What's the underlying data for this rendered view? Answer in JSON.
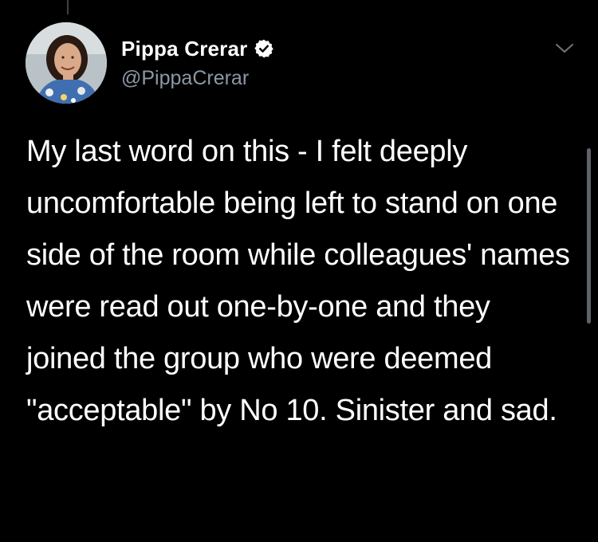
{
  "tweet": {
    "author": {
      "display_name": "Pippa Crerar",
      "handle": "@PippaCrerar",
      "verified": true,
      "avatar_icon": "profile-photo"
    },
    "text": "My last word on this - I felt deeply uncomfortable being left to stand on one side of the room while colleagues' names were read out one-by-one and they joined the group who were deemed \"acceptable\" by No 10. Sinister and sad.",
    "menu_icon": "chevron-down-icon"
  },
  "colors": {
    "background": "#000000",
    "text_primary": "#ffffff",
    "text_secondary": "#8b98a5",
    "verified_badge": "#ffffff"
  }
}
